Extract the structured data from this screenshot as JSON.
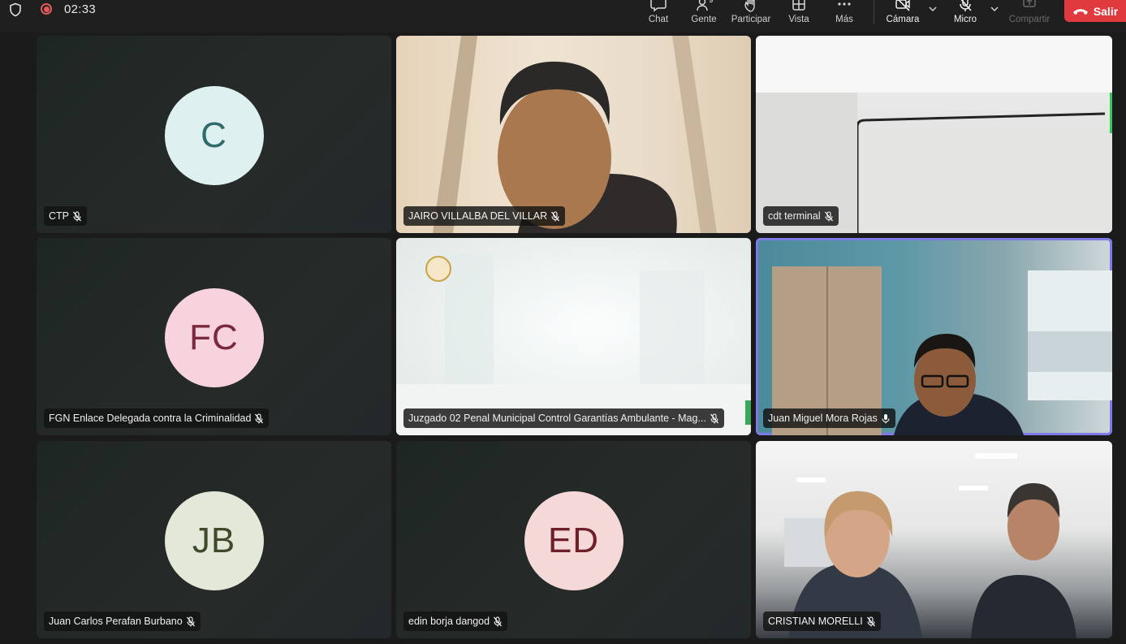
{
  "status": {
    "timer": "02:33"
  },
  "toolbar": {
    "chat": "Chat",
    "people": "Gente",
    "people_count": "9",
    "react": "Participar",
    "view": "Vista",
    "more": "Más",
    "camera": "Cámara",
    "mic": "Micro",
    "share": "Compartir",
    "leave": "Salir"
  },
  "participants": [
    {
      "name": "CTP",
      "initials": "C",
      "avatar_bg": "#dff0f0",
      "avatar_fg": "#2f6b6b",
      "muted": true
    },
    {
      "name": "JAIRO VILLALBA DEL VILLAR",
      "muted": true
    },
    {
      "name": "cdt terminal",
      "muted": true
    },
    {
      "name": "FGN Enlace Delegada contra la Criminalidad",
      "initials": "FC",
      "avatar_bg": "#f7d3dd",
      "avatar_fg": "#7a2a3c",
      "muted": true
    },
    {
      "name": "Juzgado 02 Penal Municipal Control Garantías Ambulante - Mag...",
      "muted": true
    },
    {
      "name": "Juan Miguel Mora Rojas",
      "muted": false
    },
    {
      "name": "Juan Carlos Perafan Burbano",
      "initials": "JB",
      "avatar_bg": "#e4e8d8",
      "avatar_fg": "#3e4a2c",
      "muted": true
    },
    {
      "name": "edin borja dangod",
      "initials": "ED",
      "avatar_bg": "#f5d8d8",
      "avatar_fg": "#6f1f28",
      "muted": true
    },
    {
      "name": "CRISTIAN MORELLI",
      "muted": true
    }
  ],
  "colors": {
    "leave": "#e0393e",
    "active_speaker": "#7f7ae8",
    "audio_level": "#35c759"
  }
}
